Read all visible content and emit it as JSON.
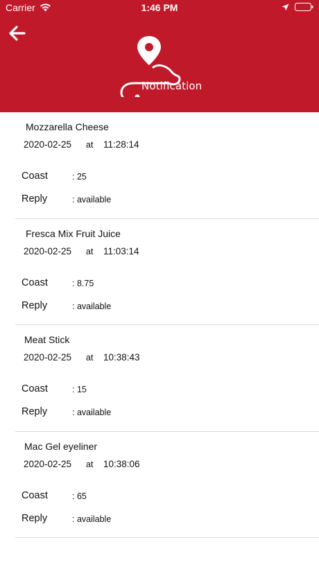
{
  "status_bar": {
    "carrier": "Carrier",
    "time": "1:46 PM",
    "icons": [
      "wifi-icon",
      "location-arrow-icon",
      "battery-icon"
    ]
  },
  "header": {
    "back_icon": "arrow-left-icon",
    "logo_icon": "map-pin-route-icon",
    "logo_text": "Notification",
    "background": "#c0192a"
  },
  "fields": {
    "at": "at",
    "coast_label": "Coast",
    "reply_label": "Reply"
  },
  "notifications": [
    {
      "product": "Mozzarella Cheese",
      "date": "2020-02-25",
      "time": "11:28:14",
      "coast": ": 25",
      "reply": ": available"
    },
    {
      "product": "Fresca Mix Fruit Juice",
      "date": "2020-02-25",
      "time": "11:03:14",
      "coast": ": 8.75",
      "reply": ": available"
    },
    {
      "product": "Meat Stick",
      "date": "2020-02-25",
      "time": "10:38:43",
      "coast": ": 15",
      "reply": ": available"
    },
    {
      "product": "Mac Gel eyeliner",
      "date": "2020-02-25",
      "time": "10:38:06",
      "coast": ": 65",
      "reply": ": available"
    }
  ]
}
